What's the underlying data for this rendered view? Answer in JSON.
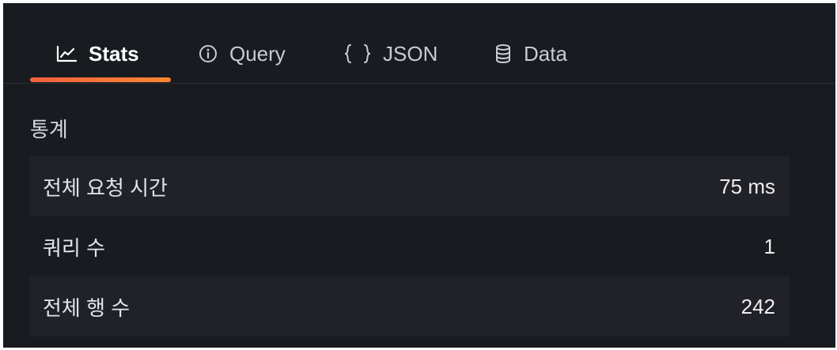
{
  "tabs": [
    {
      "label": "Stats",
      "icon": "chart-line-icon",
      "active": true
    },
    {
      "label": "Query",
      "icon": "info-circle-icon",
      "active": false
    },
    {
      "label": "JSON",
      "icon": "braces-icon",
      "active": false
    },
    {
      "label": "Data",
      "icon": "database-icon",
      "active": false
    }
  ],
  "section": {
    "title": "통계"
  },
  "stats": [
    {
      "label": "전체 요청 시간",
      "value": "75 ms"
    },
    {
      "label": "쿼리 수",
      "value": "1"
    },
    {
      "label": "전체 행 수",
      "value": "242"
    }
  ],
  "colors": {
    "panel_bg": "#181b1f",
    "row_bg": "#202227",
    "accent_start": "#f55f3e",
    "accent_end": "#ff8833"
  }
}
